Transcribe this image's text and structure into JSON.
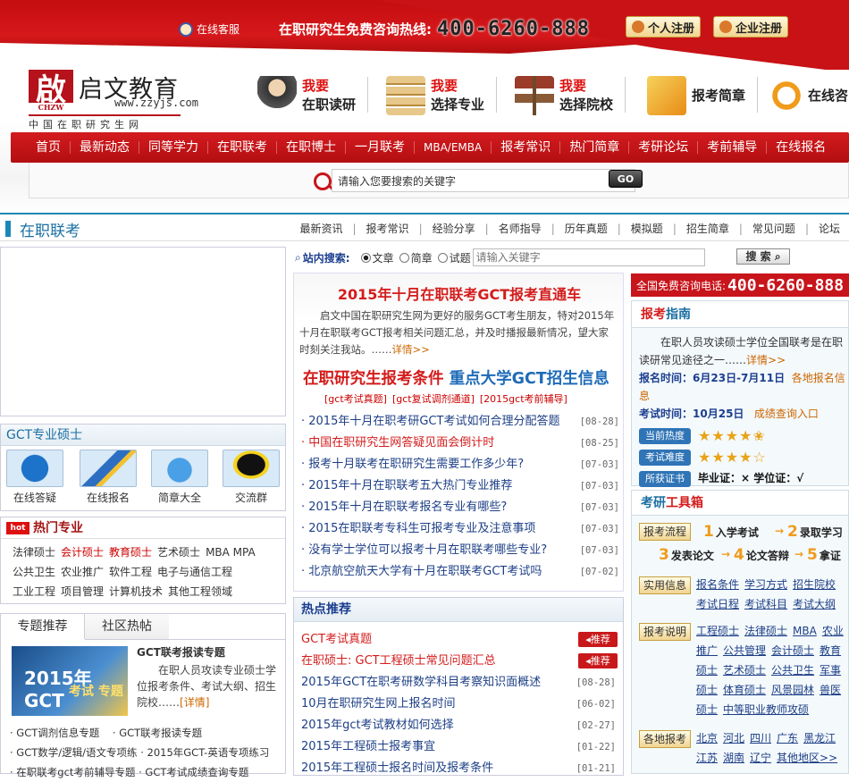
{
  "header": {
    "kefu": "在线客服",
    "hotline_label": "在职研究生免费咨询热线:",
    "hotline_number": "400-6260-888",
    "reg_personal": "个人注册",
    "reg_company": "企业注册"
  },
  "logo": {
    "mark": "啟",
    "mark_small": "CHZW",
    "name": "启文教育",
    "url": "www.zzyjs.com",
    "tagline": "中国在职研究生网"
  },
  "quick": [
    {
      "r": "我要",
      "k": "在职读研"
    },
    {
      "r": "我要",
      "k": "选择专业"
    },
    {
      "r": "我要",
      "k": "选择院校"
    },
    {
      "k": "报考简章"
    },
    {
      "k": "在线咨"
    }
  ],
  "nav": [
    "首页",
    "最新动态",
    "同等学力",
    "在职联考",
    "在职博士",
    "一月联考",
    "MBA/EMBA",
    "报考常识",
    "热门简章",
    "考研论坛",
    "考前辅导",
    "在线报名"
  ],
  "search": {
    "placeholder": "请输入您要搜索的关键字",
    "go": "GO"
  },
  "section": {
    "title": "在职联考",
    "subnav": [
      "最新资讯",
      "报考常识",
      "经验分享",
      "名师指导",
      "历年真题",
      "模拟题",
      "招生简章",
      "常见问题",
      "论坛"
    ]
  },
  "left": {
    "gct_title": "GCT专业硕士",
    "gct_icons": [
      "在线答疑",
      "在线报名",
      "简章大全",
      "交流群"
    ],
    "hot_title": "热门专业",
    "hot_lines": [
      [
        {
          "t": "法律硕士",
          "red": false
        },
        {
          "t": "会计硕士",
          "red": true
        },
        {
          "t": "教育硕士",
          "red": true
        },
        {
          "t": "艺术硕士",
          "red": false
        },
        {
          "t": "MBA MPA",
          "red": false
        }
      ],
      [
        {
          "t": "公共卫生",
          "red": false
        },
        {
          "t": "农业推广",
          "red": false
        },
        {
          "t": "软件工程",
          "red": false
        },
        {
          "t": "电子与通信工程",
          "red": false
        }
      ],
      [
        {
          "t": "工业工程",
          "red": false
        },
        {
          "t": "项目管理",
          "red": false
        },
        {
          "t": "计算机技术",
          "red": false
        },
        {
          "t": "其他工程领域",
          "red": false
        }
      ]
    ],
    "tab_on": "专题推荐",
    "tab_off": "社区热帖",
    "feature_img_a": "2015年GCT",
    "feature_img_b": "考试 专题",
    "feature_title": "GCT联考报读专题",
    "feature_desc": "在职人员攻读专业硕士学位报考条件、考试大纲、招生院校……",
    "feature_more": "[详情]",
    "links": [
      [
        "· GCT调剂信息专题",
        "· GCT联考报读专题"
      ],
      [
        "· GCT数学/逻辑/语文专项练",
        "· 2015年GCT-英语专项练习"
      ],
      [
        "· 在职联考gct考前辅导专题",
        "· GCT考试成绩查询专题"
      ]
    ]
  },
  "middle": {
    "search_label": "站内搜索:",
    "radios": [
      "文章",
      "简章",
      "试题"
    ],
    "search_placeholder": "请输入关键字",
    "search_btn": "搜 索",
    "headline": "2015年十月在职联考GCT报考直通车",
    "intro": "启文中国在职研究生网为更好的服务GCT考生朋友，特对2015年十月在职联考GCT报考相关问题汇总，并及时播报最新情况，望大家时刻关注我站。……",
    "intro_more": "详情>>",
    "h2_red": "在职研究生报考条件",
    "h2_blue": "重点大学GCT招生信息",
    "small_links": [
      "[gct考试真题]",
      "[gct复试调剂通道]",
      "[2015gct考前辅导]"
    ],
    "news": [
      {
        "t": "· 2015年十月在职考研GCT考试如何合理分配答题",
        "d": "[08-28]",
        "red": false
      },
      {
        "t": "· 中国在职研究生网答疑见面会倒计时",
        "d": "[08-25]",
        "red": true
      },
      {
        "t": "· 报考十月联考在职研究生需要工作多少年?",
        "d": "[07-03]",
        "red": false
      },
      {
        "t": "· 2015年十月在职联考五大热门专业推荐",
        "d": "[07-03]",
        "red": false
      },
      {
        "t": "· 2015年十月在职联考报名专业有哪些?",
        "d": "[07-03]",
        "red": false
      },
      {
        "t": "· 2015在职联考专科生可报考专业及注意事项",
        "d": "[07-03]",
        "red": false
      },
      {
        "t": "· 没有学士学位可以报考十月在职联考哪些专业?",
        "d": "[07-03]",
        "red": false
      },
      {
        "t": "· 北京航空航天大学有十月在职联考GCT考试吗",
        "d": "[07-02]",
        "red": false
      }
    ],
    "hot_title": "热点推荐",
    "hot": [
      {
        "t": "GCT考试真题",
        "d": "",
        "tui": "推荐",
        "red": true
      },
      {
        "t": "在职硕士: GCT工程硕士常见问题汇总",
        "d": "",
        "tui": "推荐",
        "red": true
      },
      {
        "t": "2015年GCT在职考研数学科目考察知识面概述",
        "d": "[08-28]",
        "tui": "",
        "red": false
      },
      {
        "t": "10月在职研究生网上报名时间",
        "d": "[06-02]",
        "tui": "",
        "red": false
      },
      {
        "t": "2015年gct考试教材如何选择",
        "d": "[02-27]",
        "tui": "",
        "red": false
      },
      {
        "t": "2015年工程硕士报考事宜",
        "d": "[01-22]",
        "tui": "",
        "red": false
      },
      {
        "t": "2015年工程硕士报名时间及报考条件",
        "d": "[01-21]",
        "tui": "",
        "red": false
      }
    ]
  },
  "right": {
    "hotline_label": "全国免费咨询电话:",
    "hotline": "400-6260-888",
    "guide_title_a": "报考",
    "guide_title_b": "指南",
    "guide_intro": "在职人员攻读硕士学位全国联考是在职读研常见途径之一……",
    "guide_more": "详情>>",
    "reg_time_label": "报名时间：",
    "reg_time": "6月23日-7月11日",
    "reg_time_extra": "各地报名信息",
    "exam_label": "考试时间：",
    "exam_time": "10月25日",
    "exam_extra": "成绩查询入口",
    "heat_label": "当前热度",
    "heat": 4.5,
    "diff_label": "考试难度",
    "diff": 4,
    "cert_label": "所获证书",
    "cert_text": "毕业证：×  学位证：√",
    "tool_title_a": "考研",
    "tool_title_b": "工具箱",
    "flow_label": "报考流程",
    "steps": [
      "入学考试",
      "录取学习",
      "发表论文",
      "论文答辩",
      "拿证"
    ],
    "info_label": "实用信息",
    "info_links": [
      "报名条件",
      "学习方式",
      "招生院校",
      "考试日程",
      "考试科目",
      "考试大纲"
    ],
    "exp_label": "报考说明",
    "exp_links": [
      "工程硕士",
      "法律硕士",
      "MBA",
      "农业推广",
      "公共管理",
      "会计硕士",
      "教育硕士",
      "艺术硕士",
      "公共卫生",
      "军事硕士",
      "体育硕士",
      "风景园林",
      "兽医硕士",
      "中等职业教师攻硕"
    ],
    "area_label": "各地报考",
    "area_links": [
      "北京",
      "河北",
      "四川",
      "广东",
      "黑龙江",
      "江苏",
      "湖南",
      "辽宁",
      "其他地区>>"
    ]
  }
}
